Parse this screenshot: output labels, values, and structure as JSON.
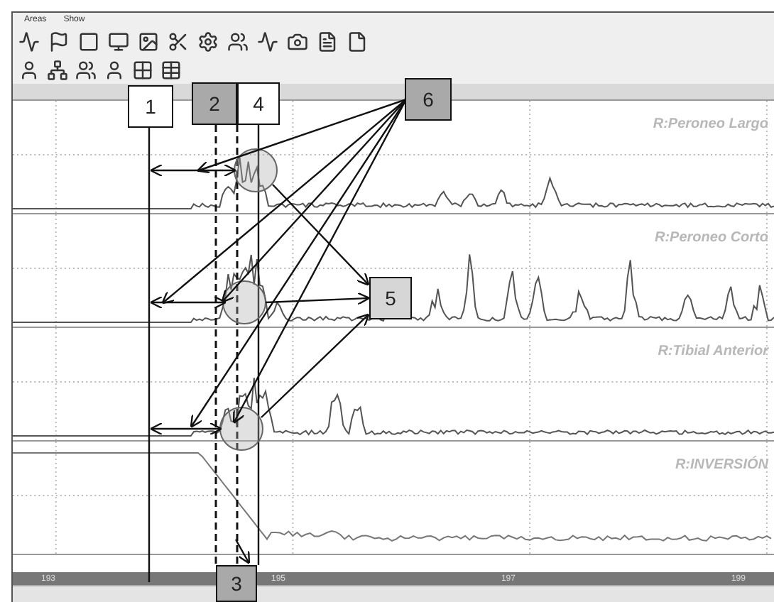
{
  "menu": [
    {
      "label": "Areas"
    },
    {
      "label": "Show"
    }
  ],
  "channels": [
    {
      "label": "R:Peroneo Largo",
      "kind": "emg"
    },
    {
      "label": "R:Peroneo Corto",
      "kind": "emg"
    },
    {
      "label": "R:Tibial Anterior",
      "kind": "emg"
    },
    {
      "label": "R:INVERSIÓN",
      "kind": "angle"
    }
  ],
  "time_axis": {
    "ticks": [
      "193",
      "195",
      "197",
      "199"
    ]
  },
  "callouts": [
    {
      "label": "1",
      "kind": "plain"
    },
    {
      "label": "2",
      "kind": "shaded"
    },
    {
      "label": "4",
      "kind": "plain"
    },
    {
      "label": "6",
      "kind": "shaded"
    },
    {
      "label": "5",
      "kind": "light"
    },
    {
      "label": "3",
      "kind": "shaded"
    }
  ]
}
